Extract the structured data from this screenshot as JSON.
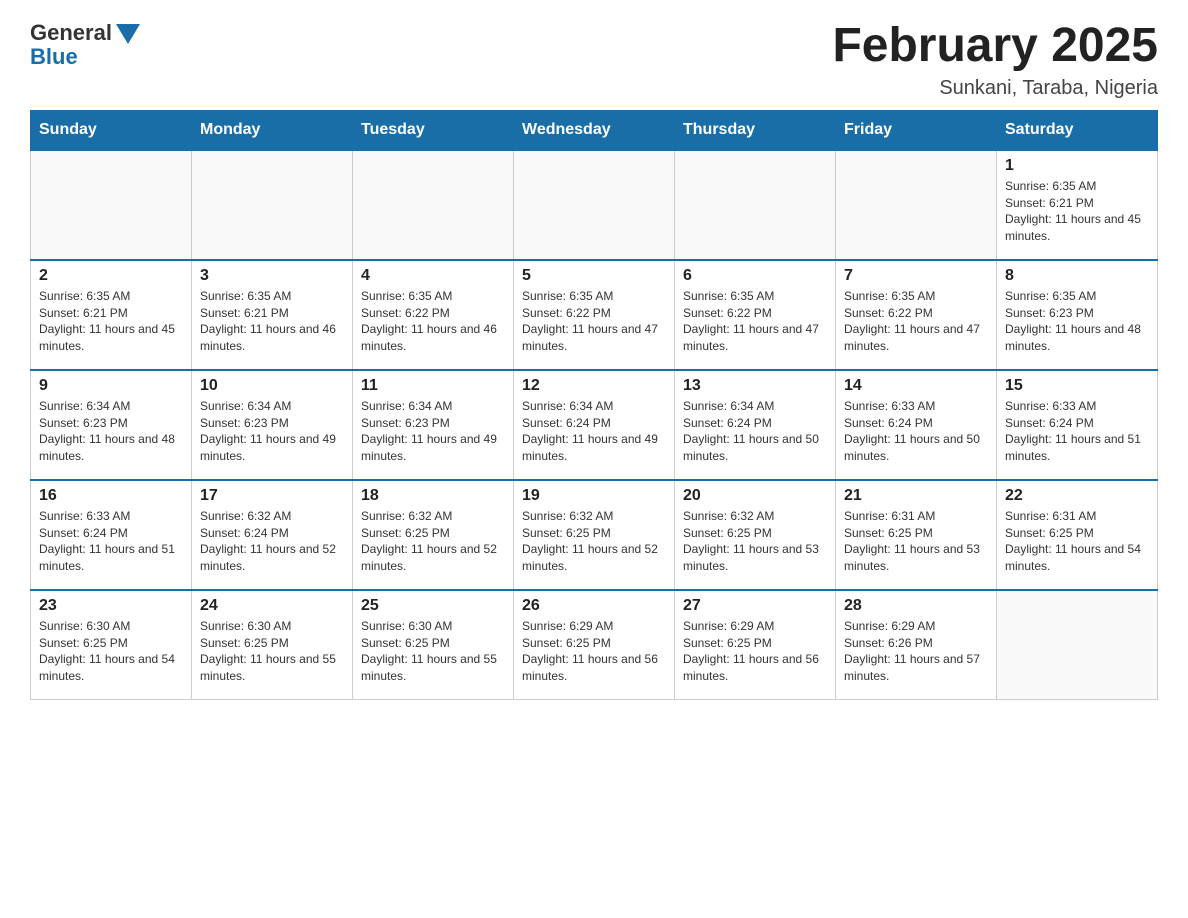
{
  "logo": {
    "general": "General",
    "blue": "Blue"
  },
  "header": {
    "title": "February 2025",
    "location": "Sunkani, Taraba, Nigeria"
  },
  "days_of_week": [
    "Sunday",
    "Monday",
    "Tuesday",
    "Wednesday",
    "Thursday",
    "Friday",
    "Saturday"
  ],
  "weeks": [
    [
      {
        "day": "",
        "info": ""
      },
      {
        "day": "",
        "info": ""
      },
      {
        "day": "",
        "info": ""
      },
      {
        "day": "",
        "info": ""
      },
      {
        "day": "",
        "info": ""
      },
      {
        "day": "",
        "info": ""
      },
      {
        "day": "1",
        "info": "Sunrise: 6:35 AM\nSunset: 6:21 PM\nDaylight: 11 hours and 45 minutes."
      }
    ],
    [
      {
        "day": "2",
        "info": "Sunrise: 6:35 AM\nSunset: 6:21 PM\nDaylight: 11 hours and 45 minutes."
      },
      {
        "day": "3",
        "info": "Sunrise: 6:35 AM\nSunset: 6:21 PM\nDaylight: 11 hours and 46 minutes."
      },
      {
        "day": "4",
        "info": "Sunrise: 6:35 AM\nSunset: 6:22 PM\nDaylight: 11 hours and 46 minutes."
      },
      {
        "day": "5",
        "info": "Sunrise: 6:35 AM\nSunset: 6:22 PM\nDaylight: 11 hours and 47 minutes."
      },
      {
        "day": "6",
        "info": "Sunrise: 6:35 AM\nSunset: 6:22 PM\nDaylight: 11 hours and 47 minutes."
      },
      {
        "day": "7",
        "info": "Sunrise: 6:35 AM\nSunset: 6:22 PM\nDaylight: 11 hours and 47 minutes."
      },
      {
        "day": "8",
        "info": "Sunrise: 6:35 AM\nSunset: 6:23 PM\nDaylight: 11 hours and 48 minutes."
      }
    ],
    [
      {
        "day": "9",
        "info": "Sunrise: 6:34 AM\nSunset: 6:23 PM\nDaylight: 11 hours and 48 minutes."
      },
      {
        "day": "10",
        "info": "Sunrise: 6:34 AM\nSunset: 6:23 PM\nDaylight: 11 hours and 49 minutes."
      },
      {
        "day": "11",
        "info": "Sunrise: 6:34 AM\nSunset: 6:23 PM\nDaylight: 11 hours and 49 minutes."
      },
      {
        "day": "12",
        "info": "Sunrise: 6:34 AM\nSunset: 6:24 PM\nDaylight: 11 hours and 49 minutes."
      },
      {
        "day": "13",
        "info": "Sunrise: 6:34 AM\nSunset: 6:24 PM\nDaylight: 11 hours and 50 minutes."
      },
      {
        "day": "14",
        "info": "Sunrise: 6:33 AM\nSunset: 6:24 PM\nDaylight: 11 hours and 50 minutes."
      },
      {
        "day": "15",
        "info": "Sunrise: 6:33 AM\nSunset: 6:24 PM\nDaylight: 11 hours and 51 minutes."
      }
    ],
    [
      {
        "day": "16",
        "info": "Sunrise: 6:33 AM\nSunset: 6:24 PM\nDaylight: 11 hours and 51 minutes."
      },
      {
        "day": "17",
        "info": "Sunrise: 6:32 AM\nSunset: 6:24 PM\nDaylight: 11 hours and 52 minutes."
      },
      {
        "day": "18",
        "info": "Sunrise: 6:32 AM\nSunset: 6:25 PM\nDaylight: 11 hours and 52 minutes."
      },
      {
        "day": "19",
        "info": "Sunrise: 6:32 AM\nSunset: 6:25 PM\nDaylight: 11 hours and 52 minutes."
      },
      {
        "day": "20",
        "info": "Sunrise: 6:32 AM\nSunset: 6:25 PM\nDaylight: 11 hours and 53 minutes."
      },
      {
        "day": "21",
        "info": "Sunrise: 6:31 AM\nSunset: 6:25 PM\nDaylight: 11 hours and 53 minutes."
      },
      {
        "day": "22",
        "info": "Sunrise: 6:31 AM\nSunset: 6:25 PM\nDaylight: 11 hours and 54 minutes."
      }
    ],
    [
      {
        "day": "23",
        "info": "Sunrise: 6:30 AM\nSunset: 6:25 PM\nDaylight: 11 hours and 54 minutes."
      },
      {
        "day": "24",
        "info": "Sunrise: 6:30 AM\nSunset: 6:25 PM\nDaylight: 11 hours and 55 minutes."
      },
      {
        "day": "25",
        "info": "Sunrise: 6:30 AM\nSunset: 6:25 PM\nDaylight: 11 hours and 55 minutes."
      },
      {
        "day": "26",
        "info": "Sunrise: 6:29 AM\nSunset: 6:25 PM\nDaylight: 11 hours and 56 minutes."
      },
      {
        "day": "27",
        "info": "Sunrise: 6:29 AM\nSunset: 6:25 PM\nDaylight: 11 hours and 56 minutes."
      },
      {
        "day": "28",
        "info": "Sunrise: 6:29 AM\nSunset: 6:26 PM\nDaylight: 11 hours and 57 minutes."
      },
      {
        "day": "",
        "info": ""
      }
    ]
  ]
}
